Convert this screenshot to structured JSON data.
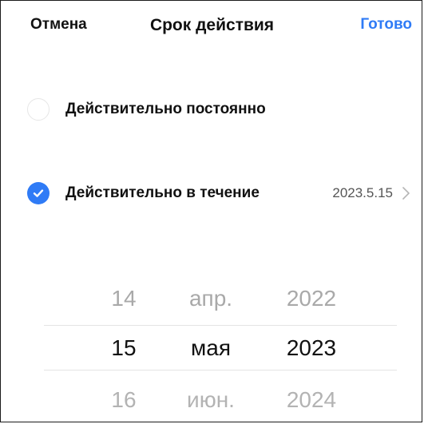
{
  "header": {
    "cancel_label": "Отмена",
    "title": "Срок действия",
    "done_label": "Готово"
  },
  "options": [
    {
      "label": "Действительно постоянно",
      "selected": false
    },
    {
      "label": "Действительно в течение",
      "selected": true,
      "value": "2023.5.15"
    }
  ],
  "picker": {
    "days": [
      "14",
      "15",
      "16"
    ],
    "months": [
      "апр.",
      "мая",
      "июн."
    ],
    "years": [
      "2022",
      "2023",
      "2024"
    ],
    "selected_index": 1
  },
  "colors": {
    "accent": "#2f7bf6",
    "text": "#111111",
    "muted": "#a9a9a9",
    "separator": "#e4e4e4"
  }
}
